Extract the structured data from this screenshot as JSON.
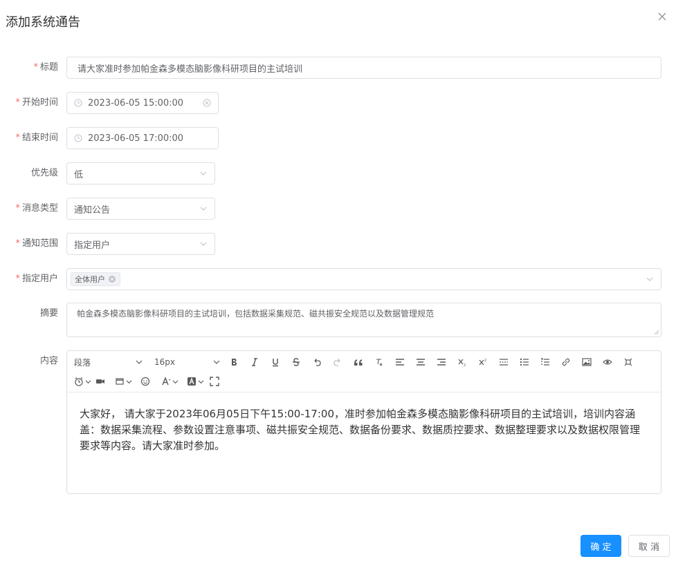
{
  "dialog": {
    "title": "添加系统通告"
  },
  "form": {
    "title": {
      "label": "标题",
      "value": "请大家准时参加帕金森多模态脑影像科研项目的主试培训"
    },
    "start_time": {
      "label": "开始时间",
      "value": "2023-06-05 15:00:00"
    },
    "end_time": {
      "label": "结束时间",
      "value": "2023-06-05 17:00:00"
    },
    "priority": {
      "label": "优先级",
      "value": "低"
    },
    "msg_type": {
      "label": "消息类型",
      "value": "通知公告"
    },
    "scope": {
      "label": "通知范围",
      "value": "指定用户"
    },
    "users": {
      "label": "指定用户",
      "tags": [
        "全体用户"
      ]
    },
    "summary": {
      "label": "摘要",
      "value": "帕金森多模态脑影像科研项目的主试培训，包括数据采集规范、磁共振安全规范以及数据管理规范"
    },
    "content": {
      "label": "内容",
      "toolbar": {
        "heading": "段落",
        "font_size": "16px"
      },
      "text": "大家好， 请大家于2023年06月05日下午15:00-17:00，准时参加帕金森多模态脑影像科研项目的主试培训，培训内容涵盖：数据采集流程、参数设置注意事项、磁共振安全规范、数据备份要求、数据质控要求、数据整理要求以及数据权限管理要求等内容。请大家准时参加。"
    }
  },
  "buttons": {
    "confirm": "确 定",
    "cancel": "取 消"
  },
  "colors": {
    "primary": "#1890ff",
    "required": "#f56c6c",
    "border": "#dcdfe6"
  }
}
